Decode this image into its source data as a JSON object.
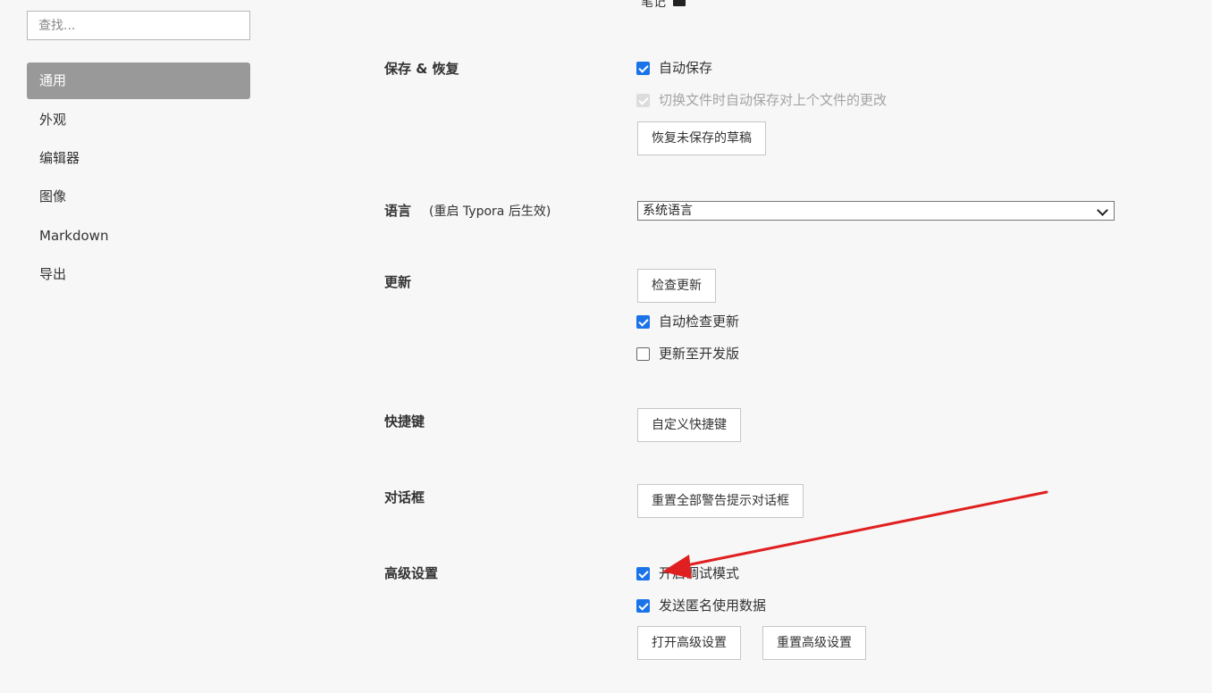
{
  "search": {
    "placeholder": "查找..."
  },
  "sidebar": {
    "items": [
      {
        "label": "通用",
        "active": true
      },
      {
        "label": "外观"
      },
      {
        "label": "编辑器"
      },
      {
        "label": "图像"
      },
      {
        "label": "Markdown"
      },
      {
        "label": "导出"
      }
    ]
  },
  "top_partial": {
    "label": "笔记"
  },
  "save": {
    "title": "保存 & 恢复",
    "autosave": "自动保存",
    "autosave_on_switch": "切换文件时自动保存对上个文件的更改",
    "recover_button": "恢复未保存的草稿"
  },
  "language": {
    "title": "语言",
    "hint": "(重启 Typora 后生效)",
    "selected": "系统语言"
  },
  "update": {
    "title": "更新",
    "check_button": "检查更新",
    "auto_check": "自动检查更新",
    "dev_channel": "更新至开发版"
  },
  "shortcuts": {
    "title": "快捷键",
    "custom_button": "自定义快捷键"
  },
  "dialogs": {
    "title": "对话框",
    "reset_button": "重置全部警告提示对话框"
  },
  "advanced": {
    "title": "高级设置",
    "debug_mode": "开启调试模式",
    "send_anonymous": "发送匿名使用数据",
    "open_button": "打开高级设置",
    "reset_button": "重置高级设置"
  },
  "colors": {
    "accent": "#1a73e8",
    "active_nav": "#999999",
    "annotation_arrow": "#e02020"
  }
}
